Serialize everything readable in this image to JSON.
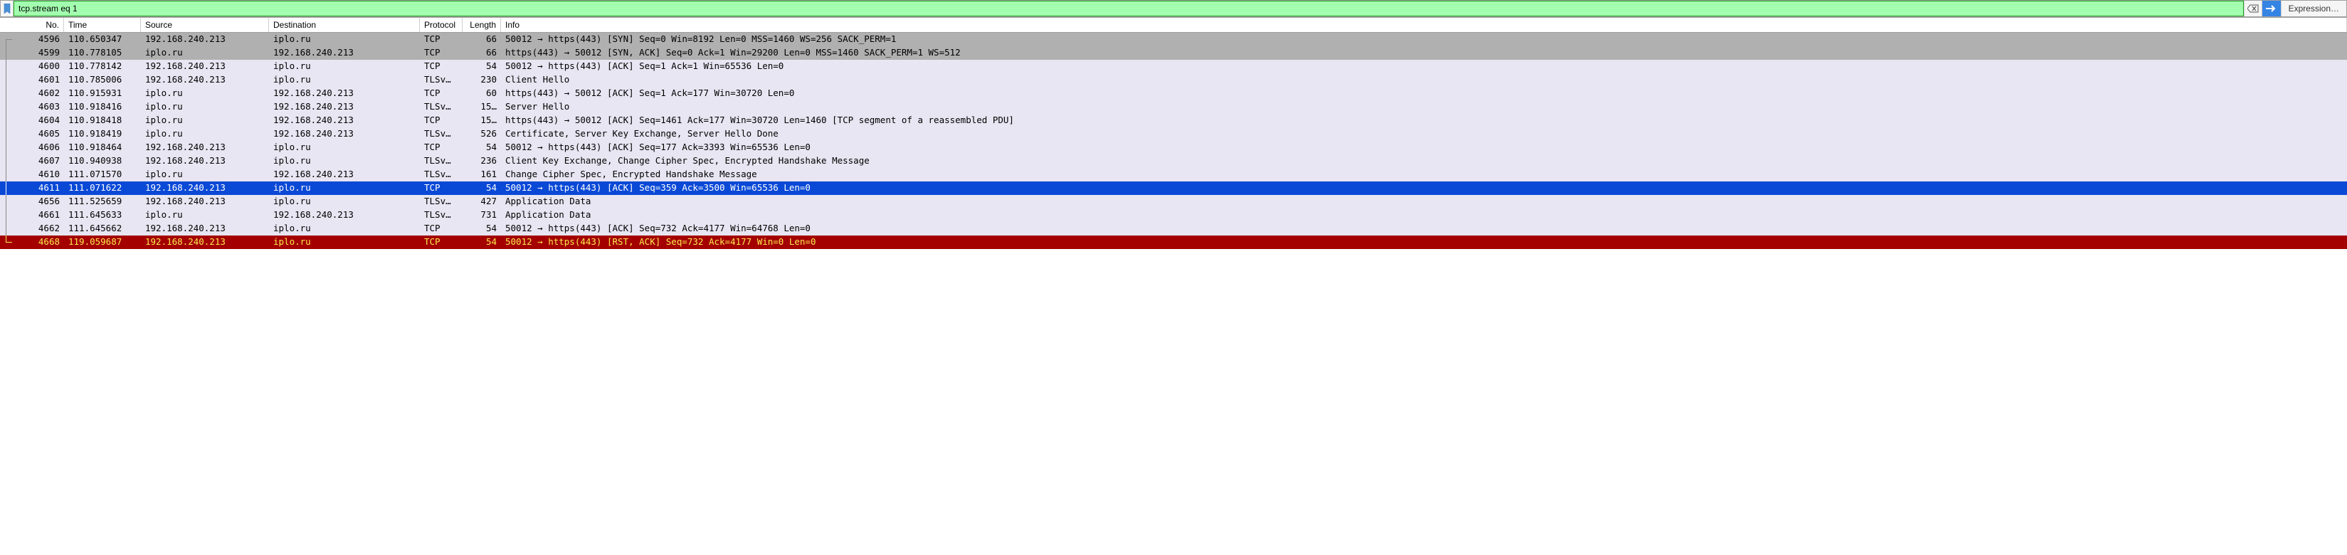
{
  "filter": {
    "value": "tcp.stream eq 1",
    "expression_label": "Expression…"
  },
  "columns": {
    "no": "No.",
    "time": "Time",
    "source": "Source",
    "destination": "Destination",
    "protocol": "Protocol",
    "length": "Length",
    "info": "Info"
  },
  "icons": {
    "bookmark": "bookmark-icon",
    "clear": "clear-icon",
    "apply": "apply-arrow-icon"
  },
  "packets": [
    {
      "no": "4596",
      "time": "110.650347",
      "src": "192.168.240.213",
      "dst": "iplo.ru",
      "proto": "TCP",
      "len": "66",
      "info": "50012 → https(443) [SYN] Seq=0 Win=8192 Len=0 MSS=1460 WS=256 SACK_PERM=1",
      "style": "gray",
      "tree": "first"
    },
    {
      "no": "4599",
      "time": "110.778105",
      "src": "iplo.ru",
      "dst": "192.168.240.213",
      "proto": "TCP",
      "len": "66",
      "info": "https(443) → 50012 [SYN, ACK] Seq=0 Ack=1 Win=29200 Len=0 MSS=1460 SACK_PERM=1 WS=512",
      "style": "gray",
      "tree": "mid"
    },
    {
      "no": "4600",
      "time": "110.778142",
      "src": "192.168.240.213",
      "dst": "iplo.ru",
      "proto": "TCP",
      "len": "54",
      "info": "50012 → https(443) [ACK] Seq=1 Ack=1 Win=65536 Len=0",
      "style": "lav",
      "tree": "mid"
    },
    {
      "no": "4601",
      "time": "110.785006",
      "src": "192.168.240.213",
      "dst": "iplo.ru",
      "proto": "TLSv…",
      "len": "230",
      "info": "Client Hello",
      "style": "lav",
      "tree": "mid"
    },
    {
      "no": "4602",
      "time": "110.915931",
      "src": "iplo.ru",
      "dst": "192.168.240.213",
      "proto": "TCP",
      "len": "60",
      "info": "https(443) → 50012 [ACK] Seq=1 Ack=177 Win=30720 Len=0",
      "style": "lav",
      "tree": "mid"
    },
    {
      "no": "4603",
      "time": "110.918416",
      "src": "iplo.ru",
      "dst": "192.168.240.213",
      "proto": "TLSv…",
      "len": "15…",
      "info": "Server Hello",
      "style": "lav",
      "tree": "mid"
    },
    {
      "no": "4604",
      "time": "110.918418",
      "src": "iplo.ru",
      "dst": "192.168.240.213",
      "proto": "TCP",
      "len": "15…",
      "info": "https(443) → 50012 [ACK] Seq=1461 Ack=177 Win=30720 Len=1460 [TCP segment of a reassembled PDU]",
      "style": "lav",
      "tree": "mid"
    },
    {
      "no": "4605",
      "time": "110.918419",
      "src": "iplo.ru",
      "dst": "192.168.240.213",
      "proto": "TLSv…",
      "len": "526",
      "info": "Certificate, Server Key Exchange, Server Hello Done",
      "style": "lav",
      "tree": "mid"
    },
    {
      "no": "4606",
      "time": "110.918464",
      "src": "192.168.240.213",
      "dst": "iplo.ru",
      "proto": "TCP",
      "len": "54",
      "info": "50012 → https(443) [ACK] Seq=177 Ack=3393 Win=65536 Len=0",
      "style": "lav",
      "tree": "mid"
    },
    {
      "no": "4607",
      "time": "110.940938",
      "src": "192.168.240.213",
      "dst": "iplo.ru",
      "proto": "TLSv…",
      "len": "236",
      "info": "Client Key Exchange, Change Cipher Spec, Encrypted Handshake Message",
      "style": "lav",
      "tree": "mid"
    },
    {
      "no": "4610",
      "time": "111.071570",
      "src": "iplo.ru",
      "dst": "192.168.240.213",
      "proto": "TLSv…",
      "len": "161",
      "info": "Change Cipher Spec, Encrypted Handshake Message",
      "style": "lav",
      "tree": "mid"
    },
    {
      "no": "4611",
      "time": "111.071622",
      "src": "192.168.240.213",
      "dst": "iplo.ru",
      "proto": "TCP",
      "len": "54",
      "info": "50012 → https(443) [ACK] Seq=359 Ack=3500 Win=65536 Len=0",
      "style": "sel",
      "tree": "mid"
    },
    {
      "no": "4656",
      "time": "111.525659",
      "src": "192.168.240.213",
      "dst": "iplo.ru",
      "proto": "TLSv…",
      "len": "427",
      "info": "Application Data",
      "style": "lav",
      "tree": "mid"
    },
    {
      "no": "4661",
      "time": "111.645633",
      "src": "iplo.ru",
      "dst": "192.168.240.213",
      "proto": "TLSv…",
      "len": "731",
      "info": "Application Data",
      "style": "lav",
      "tree": "mid"
    },
    {
      "no": "4662",
      "time": "111.645662",
      "src": "192.168.240.213",
      "dst": "iplo.ru",
      "proto": "TCP",
      "len": "54",
      "info": "50012 → https(443) [ACK] Seq=732 Ack=4177 Win=64768 Len=0",
      "style": "lav",
      "tree": "mid"
    },
    {
      "no": "4668",
      "time": "119.059687",
      "src": "192.168.240.213",
      "dst": "iplo.ru",
      "proto": "TCP",
      "len": "54",
      "info": "50012 → https(443) [RST, ACK] Seq=732 Ack=4177 Win=0 Len=0",
      "style": "red",
      "tree": "last"
    }
  ]
}
